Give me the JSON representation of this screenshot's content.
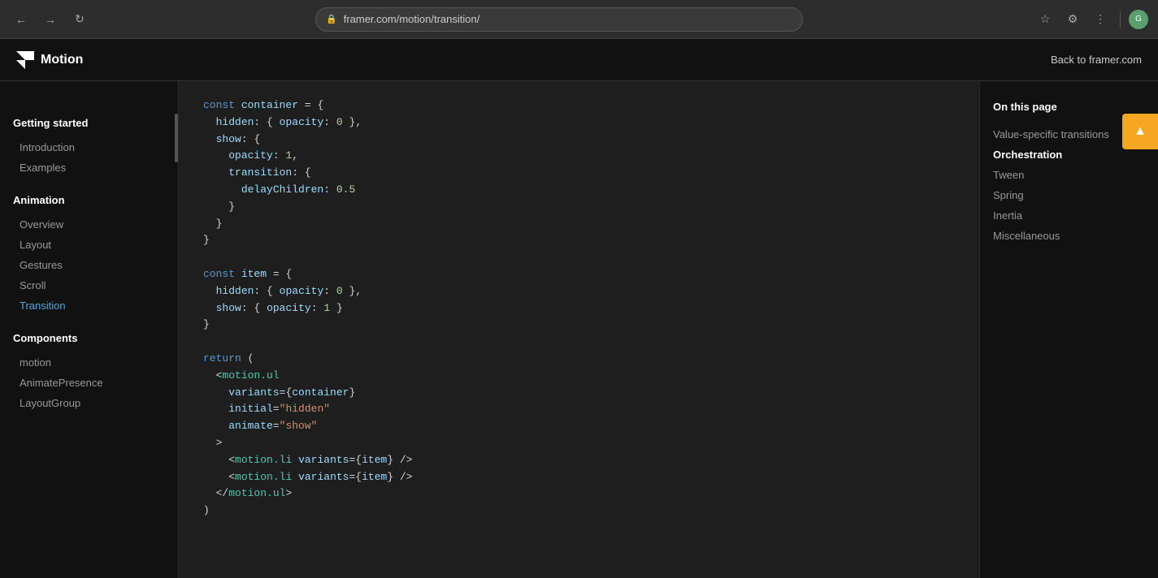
{
  "browser": {
    "url": "framer.com/motion/transition/",
    "back_label": "←",
    "forward_label": "→",
    "refresh_label": "↻"
  },
  "top_nav": {
    "logo_text": "Motion",
    "back_link": "Back to framer.com"
  },
  "sidebar": {
    "sections": [
      {
        "title": "Getting started",
        "items": [
          {
            "label": "Introduction",
            "active": false
          },
          {
            "label": "Examples",
            "active": false
          }
        ]
      },
      {
        "title": "Animation",
        "items": [
          {
            "label": "Overview",
            "active": false
          },
          {
            "label": "Layout",
            "active": false
          },
          {
            "label": "Gestures",
            "active": false
          },
          {
            "label": "Scroll",
            "active": false
          },
          {
            "label": "Transition",
            "active": true
          }
        ]
      },
      {
        "title": "Components",
        "items": [
          {
            "label": "motion",
            "active": false
          },
          {
            "label": "AnimatePresence",
            "active": false
          },
          {
            "label": "LayoutGroup",
            "active": false
          }
        ]
      }
    ]
  },
  "right_sidebar": {
    "title": "On this page",
    "items": [
      {
        "label": "Value-specific transitions",
        "active": false
      },
      {
        "label": "Orchestration",
        "active": true
      },
      {
        "label": "Tween",
        "active": false
      },
      {
        "label": "Spring",
        "active": false
      },
      {
        "label": "Inertia",
        "active": false
      },
      {
        "label": "Miscellaneous",
        "active": false
      }
    ]
  },
  "floating_btn": {
    "icon": "▲"
  }
}
